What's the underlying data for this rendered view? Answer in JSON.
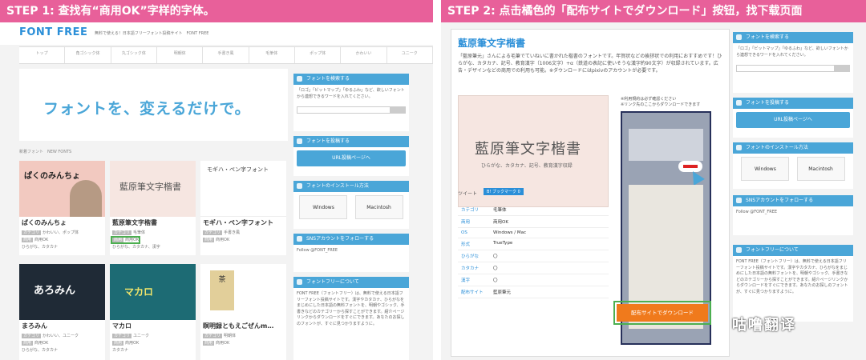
{
  "left": {
    "step_banner": "STEP 1: 查找有“商用OK”字样的字体。",
    "logo": "FONT FREE",
    "tagline": "無料で使える！日本語フリーフォント投稿サイト　FONT FREE",
    "nav": [
      {
        "label": "トップ",
        "sub": ""
      },
      {
        "label": "角ゴシック体",
        "sub": ""
      },
      {
        "label": "丸ゴシック体",
        "sub": ""
      },
      {
        "label": "明朝体",
        "sub": ""
      },
      {
        "label": "手書き風",
        "sub": ""
      },
      {
        "label": "毛筆体",
        "sub": ""
      },
      {
        "label": "ポップ体",
        "sub": ""
      },
      {
        "label": "かわいい",
        "sub": ""
      },
      {
        "label": "ユニーク",
        "sub": ""
      }
    ],
    "hero_text": "フォントを、変えるだけで。",
    "breadcrumb": "新着フォント　NEW FONTS",
    "cards": [
      {
        "title": "ぱくのみんちょ",
        "tags": "かわいい、ポップ体",
        "license": "商用OK",
        "extra": "ひらがな、カタカナ",
        "thumb": "ぱくのみんちょ"
      },
      {
        "title": "藍原筆文字楷書",
        "tags": "毛筆体",
        "license": "商用OK",
        "extra": "ひらがな、カタカナ、漢字",
        "thumb": "藍原筆文字楷書"
      },
      {
        "title": "モギハ・ペン字フォント",
        "tags": "手書き風",
        "license": "商用OK",
        "extra": "",
        "thumb": "モギハ・ペン字フォント"
      },
      {
        "title": "まろみん",
        "tags": "かわいい、ユニーク",
        "license": "商用OK",
        "extra": "ひらがな、カタカナ",
        "thumb": "あろみん"
      },
      {
        "title": "マカロ",
        "tags": "ユニーク",
        "license": "商用OK",
        "extra": "カタカナ",
        "thumb": "マカロ"
      },
      {
        "title": "瞑明録ともえごぜんm…",
        "tags": "明朝体",
        "license": "商用OK",
        "extra": "",
        "thumb": "茶"
      }
    ],
    "sidebar": {
      "search_title": "フォントを検索する",
      "search_desc": "「ロゴ」「ビットマップ」「ゆるふわ」など、欲しいフォントから連想できるワードを入れてください。",
      "post_title": "フォントを投稿する",
      "post_button": "URL投稿ページへ",
      "install_title": "フォントのインストール方法",
      "windows": "Windows",
      "mac": "Macintosh",
      "sns_title": "SNSアカウントをフォローする",
      "sns_follow": "Follow @FONT_FREE",
      "about_title": "フォントフリーについて",
      "about_desc": "FONT FREE（フォントフリー）は、無料で使える日本語フリーフォント投稿サイトです。漢字やカタカナ、ひらがなをまじめにした日本語の無料フォントを、明朝やゴシック、手書きなどのカテゴリーから探すことができます。紹介ページリンクからダウンロードをすぐにできます。あなたのお探しのフォントが、すぐに見つかりますように。"
    }
  },
  "right": {
    "step_banner": "STEP 2: 点击橘色的「配布サイトでダウンロード」按钮，找下载页面",
    "title": "藍原筆文字楷書",
    "description": "「藍原筆元」さんによる毛筆でていねいに書かれた楷書のフォントです。年賀状などの挨拶状での利用におすすめです！ひらがな、カタカナ、記号、教育漢字（1006文字）+α（鉄道の表記に使いそうな漢字約90文字）が収録されています。広告・デザインなどの商用での利用も可能。※ダウンロードにはpixivのアカウントが必要です。",
    "image_title": "藍原筆文字楷書",
    "image_sub": "ひらがな、カタカナ、記号、教育漢字収録",
    "notice": "※利用規約は必ず確認ください\n※リンク先のここからダウンロードできます",
    "tweet": "ツイート",
    "bookmark": "B! ブックマーク 0",
    "info": [
      {
        "k": "カテゴリ",
        "v": "毛筆体"
      },
      {
        "k": "商用",
        "v": "商用OK"
      },
      {
        "k": "OS",
        "v": "Windows / Mac"
      },
      {
        "k": "形式",
        "v": "TrueType"
      },
      {
        "k": "ひらがな",
        "v": "〇"
      },
      {
        "k": "カタカナ",
        "v": "〇"
      },
      {
        "k": "漢字",
        "v": "〇"
      },
      {
        "k": "配布サイト",
        "v": "藍原筆元"
      }
    ],
    "download_button": "配布サイトでダウンロード",
    "watermark": "咕噜翻译",
    "sidebar": {
      "search_title": "フォントを検索する",
      "search_desc": "「ロゴ」「ビットマップ」「ゆるふわ」など、欲しいフォントから連想できるワードを入れてください。",
      "post_title": "フォントを投稿する",
      "post_button": "URL投稿ページへ",
      "install_title": "フォントのインストール方法",
      "windows": "Windows",
      "mac": "Macintosh",
      "sns_title": "SNSアカウントをフォローする",
      "sns_follow": "Follow @FONT_FREE",
      "about_title": "フォントフリーについて",
      "about_desc": "FONT FREE（フォントフリー）は、無料で使える日本語フリーフォント投稿サイトです。漢字やカタカナ、ひらがなをまじめにした日本語の無料フォントを、明朝やゴシック、手書きなどのカテゴリーから探すことができます。紹介ページリンクからダウンロードをすぐにできます。あなたのお探しのフォントが、すぐに見つかりますように。"
    }
  }
}
